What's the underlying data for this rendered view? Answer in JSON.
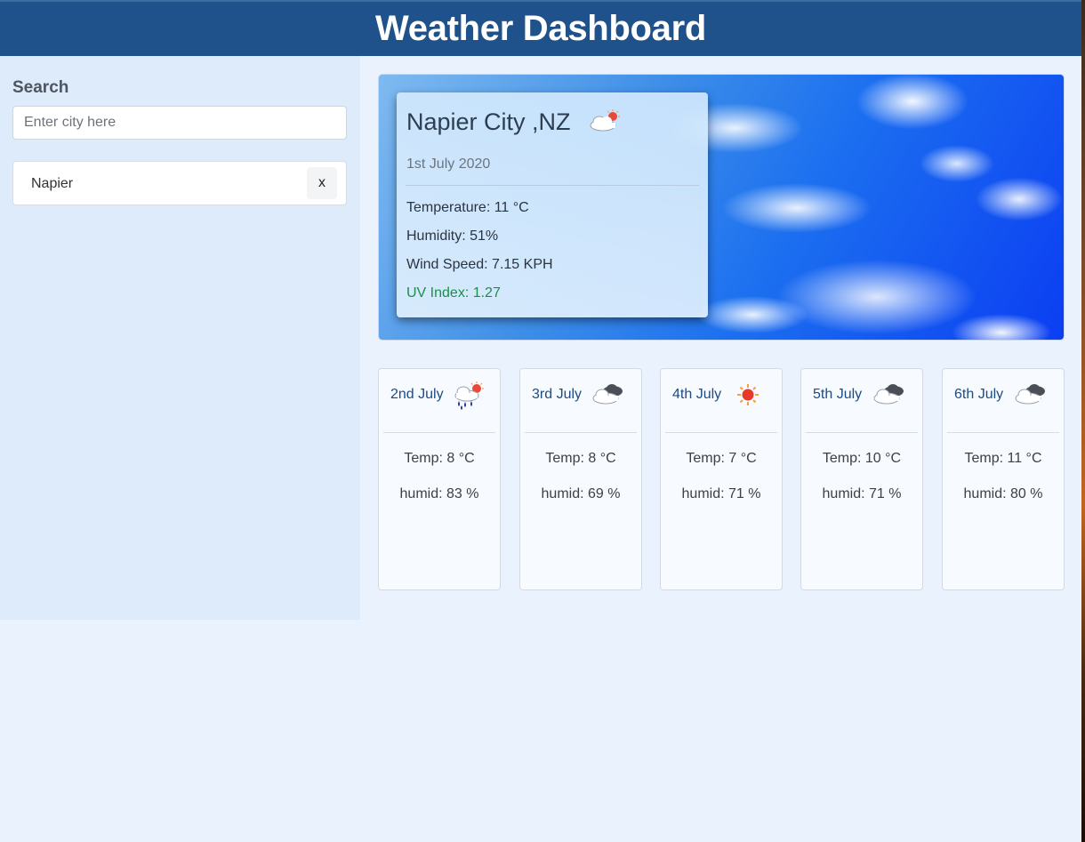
{
  "header": {
    "title": "Weather Dashboard"
  },
  "sidebar": {
    "search_label": "Search",
    "search_placeholder": "Enter city here",
    "search_value": "",
    "history": [
      {
        "label": "Napier",
        "remove_label": "x"
      }
    ]
  },
  "current": {
    "city": "Napier City ,NZ",
    "icon": "partly-cloudy-icon",
    "date": "1st July 2020",
    "temperature": "Temperature: 11 °C",
    "humidity": "Humidity: 51%",
    "wind": "Wind Speed: 7.15 KPH",
    "uv": "UV Index: 1.27",
    "uv_color": "#1a8f4b"
  },
  "forecast": [
    {
      "date": "2nd July",
      "icon": "rain-sun-icon",
      "temp": "Temp: 8 °C",
      "humid": "humid: 83 %"
    },
    {
      "date": "3rd July",
      "icon": "cloudy-icon",
      "temp": "Temp: 8 °C",
      "humid": "humid: 69 %"
    },
    {
      "date": "4th July",
      "icon": "sun-icon",
      "temp": "Temp: 7 °C",
      "humid": "humid: 71 %"
    },
    {
      "date": "5th July",
      "icon": "cloudy-icon",
      "temp": "Temp: 10 °C",
      "humid": "humid: 71 %"
    },
    {
      "date": "6th July",
      "icon": "cloudy-icon",
      "temp": "Temp: 11 °C",
      "humid": "humid: 80 %"
    }
  ],
  "colors": {
    "header_bg": "#1f528a",
    "sidebar_bg": "#deebfb",
    "page_bg": "#e9f2fd",
    "forecast_date": "#1d4c82"
  }
}
